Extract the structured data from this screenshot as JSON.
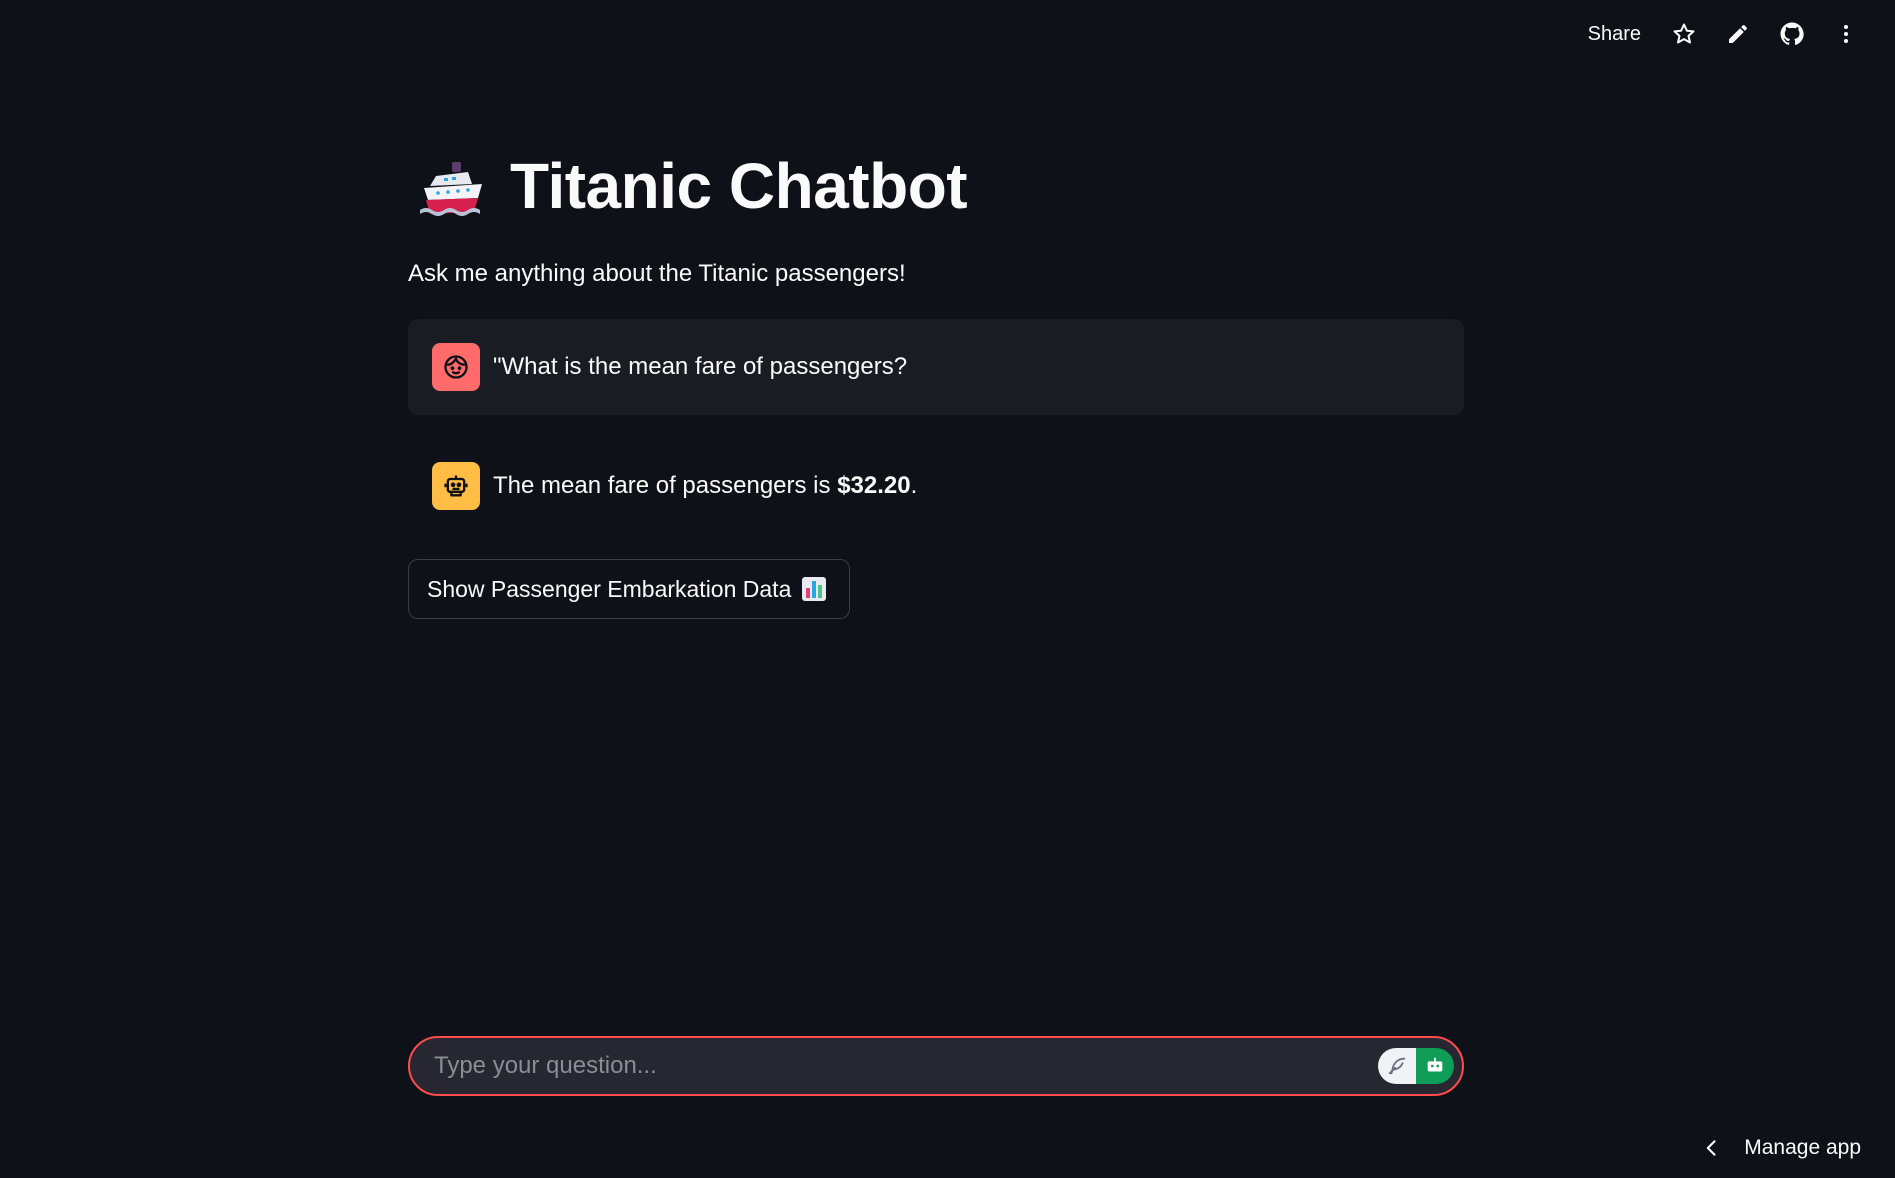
{
  "toolbar": {
    "share_label": "Share",
    "icons": [
      "star-icon",
      "pencil-icon",
      "github-icon",
      "more-vertical-icon"
    ]
  },
  "header": {
    "title_icon": "ship-emoji",
    "title": "Titanic Chatbot",
    "subtitle": "Ask me anything about the Titanic passengers!"
  },
  "chat": {
    "messages": [
      {
        "role": "user",
        "avatar": "user-face-icon",
        "text": "\"What is the mean fare of passengers?"
      },
      {
        "role": "assistant",
        "avatar": "robot-icon",
        "text_prefix": "The mean fare of passengers is ",
        "text_bold": "$32.20",
        "text_suffix": "."
      }
    ]
  },
  "action_button": {
    "label": "Show Passenger Embarkation Data",
    "icon": "bar-chart-emoji"
  },
  "chat_input": {
    "placeholder": "Type your question...",
    "value": ""
  },
  "footer": {
    "manage_label": "Manage app"
  },
  "colors": {
    "background": "#0e1117",
    "user_avatar": "#ff6b6b",
    "assistant_avatar": "#ffbd45",
    "input_border": "#ff4b4b",
    "user_message_bg": "#1a1c24"
  }
}
